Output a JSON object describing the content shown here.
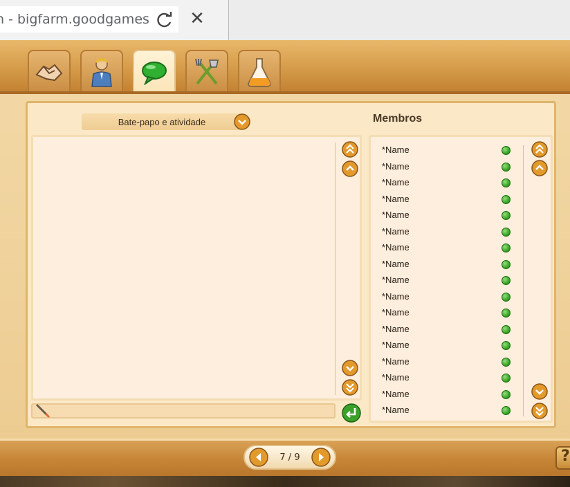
{
  "browser": {
    "tab_title": "n - bigfarm.goodgames",
    "close_glyph": "✕"
  },
  "tabs": [
    {
      "name": "handshake-icon",
      "active": false
    },
    {
      "name": "person-icon",
      "active": false
    },
    {
      "name": "chat-bubble-icon",
      "active": true
    },
    {
      "name": "tools-icon",
      "active": false
    },
    {
      "name": "flask-icon",
      "active": false
    }
  ],
  "chat": {
    "dropdown_label": "Bate-papo e atividade"
  },
  "members": {
    "title": "Membros",
    "items": [
      {
        "name": "*Name",
        "status": "online"
      },
      {
        "name": "*Name",
        "status": "online"
      },
      {
        "name": "*Name",
        "status": "online"
      },
      {
        "name": "*Name",
        "status": "online"
      },
      {
        "name": "*Name",
        "status": "online"
      },
      {
        "name": "*Name",
        "status": "online"
      },
      {
        "name": "*Name",
        "status": "online"
      },
      {
        "name": "*Name",
        "status": "online"
      },
      {
        "name": "*Name",
        "status": "online"
      },
      {
        "name": "*Name",
        "status": "online"
      },
      {
        "name": "*Name",
        "status": "online"
      },
      {
        "name": "*Name",
        "status": "online"
      },
      {
        "name": "*Name",
        "status": "online"
      },
      {
        "name": "*Name",
        "status": "online"
      },
      {
        "name": "*Name",
        "status": "online"
      },
      {
        "name": "*Name",
        "status": "online"
      },
      {
        "name": "*Name",
        "status": "online"
      }
    ]
  },
  "pager": {
    "label": "7 / 9"
  },
  "help": {
    "label": "?"
  },
  "colors": {
    "online": "#2f9a1c",
    "accent_orange": "#e39a2c",
    "send_green": "#3aa12a"
  }
}
